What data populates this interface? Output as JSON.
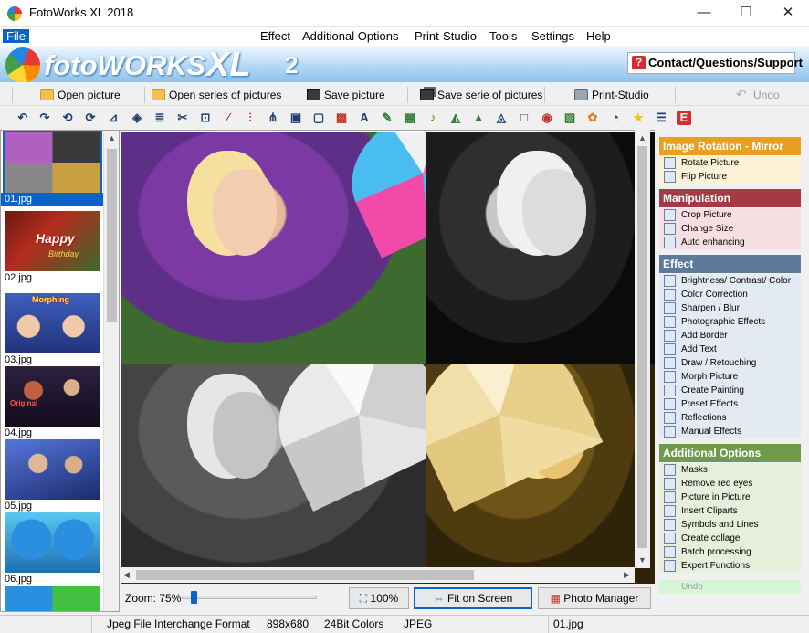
{
  "window": {
    "title": "FotoWorks XL 2018",
    "controls": {
      "minimize": "—",
      "maximize": "☐",
      "close": "✕"
    }
  },
  "menu": [
    {
      "label": "File",
      "active": true
    },
    {
      "label": "Effect"
    },
    {
      "label": "Additional Options"
    },
    {
      "label": "Print-Studio"
    },
    {
      "label": "Tools"
    },
    {
      "label": "Settings"
    },
    {
      "label": "Help"
    }
  ],
  "banner": {
    "logo_text": "fotoWORKS",
    "logo_xl": "XL",
    "logo_num": "2",
    "contact_label": "Contact/Questions/Support"
  },
  "toolbar": {
    "open_picture": "Open picture",
    "open_series": "Open series of pictures",
    "save_picture": "Save picture",
    "save_serie": "Save serie of pictures",
    "print_studio": "Print-Studio",
    "undo": "Undo"
  },
  "tool_icons": [
    "rotate-left-icon",
    "rotate-right-icon",
    "rotate-ccw-icon",
    "rotate-cw-icon",
    "level-icon",
    "cube-icon",
    "stack-icon",
    "scissors-icon",
    "crop-icon",
    "wand-icon",
    "levels-icon",
    "sharpen-icon",
    "camera-icon",
    "frame-icon",
    "text-icon",
    "draw-icon",
    "image-edit-icon",
    "brush-icon",
    "preset-icon",
    "mountain-icon",
    "morph-icon",
    "square-icon",
    "eye-icon",
    "picture-icon",
    "clipart-icon",
    "bucket-icon",
    "star-icon",
    "batch-icon",
    "expert-icon"
  ],
  "thumbnails": [
    {
      "caption": "01.jpg",
      "selected": true
    },
    {
      "caption": "02.jpg"
    },
    {
      "caption": "03.jpg"
    },
    {
      "caption": "04.jpg"
    },
    {
      "caption": "05.jpg"
    },
    {
      "caption": "06.jpg"
    }
  ],
  "thumb_texts": {
    "happy": "Happy",
    "birthday": "Birthday",
    "morphing": "Morphing",
    "original": "Original"
  },
  "viewer": {
    "zoom_label": "Zoom: 75%",
    "zoom_percent": 75,
    "btn_100": "100%",
    "btn_fit": "Fit on Screen",
    "btn_manager": "Photo Manager"
  },
  "side_panel": [
    {
      "header": "Image Rotation - Mirror",
      "color": "#e8a020",
      "bg": "#fdf2d6",
      "items": [
        "Rotate Picture",
        "Flip Picture"
      ]
    },
    {
      "header": "Manipulation",
      "color": "#a33a44",
      "bg": "#f6dfe2",
      "items": [
        "Crop Picture",
        "Change Size",
        "Auto enhancing"
      ]
    },
    {
      "header": "Effect",
      "color": "#5f7a98",
      "bg": "#e3eaf3",
      "items": [
        "Brightness/ Contrast/ Color",
        "Color Correction",
        "Sharpen / Blur",
        "Photographic Effects",
        "Add Border",
        "Add Text",
        "Draw / Retouching",
        "Morph Picture",
        "Create Painting",
        "Preset Effects",
        "Reflections",
        "Manual Effects"
      ]
    },
    {
      "header": "Additional Options",
      "color": "#6e9a4a",
      "bg": "#e6efdc",
      "items": [
        "Masks",
        "Remove red eyes",
        "Picture in Picture",
        "Insert Cliparts",
        "Symbols and Lines",
        "Create collage",
        "Batch processing",
        "Expert Functions"
      ]
    }
  ],
  "side_undo": "Undo",
  "status": {
    "format": "Jpeg File Interchange Format",
    "dimensions": "898x680",
    "colors": "24Bit Colors",
    "type": "JPEG",
    "filename": "01.jpg"
  }
}
